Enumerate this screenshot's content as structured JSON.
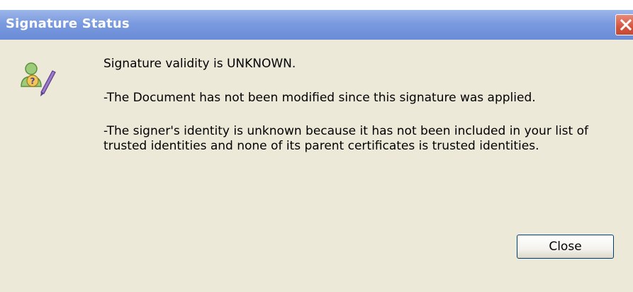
{
  "window": {
    "title": "Signature Status"
  },
  "message": {
    "line1": "Signature validity is UNKNOWN.",
    "line2": "-The Document has not been modified since this signature was applied.",
    "line3": "-The signer's identity is unknown because it has not been included in your list of trusted identities and none of its parent certificates is trusted identities."
  },
  "buttons": {
    "close_label": "Close"
  },
  "icons": {
    "status_icon": "signature-unknown-icon",
    "title_close": "close-icon"
  },
  "colors": {
    "titlebar": "#7a9be0",
    "dialog_bg": "#ece9d8",
    "close_red": "#d5553f"
  }
}
